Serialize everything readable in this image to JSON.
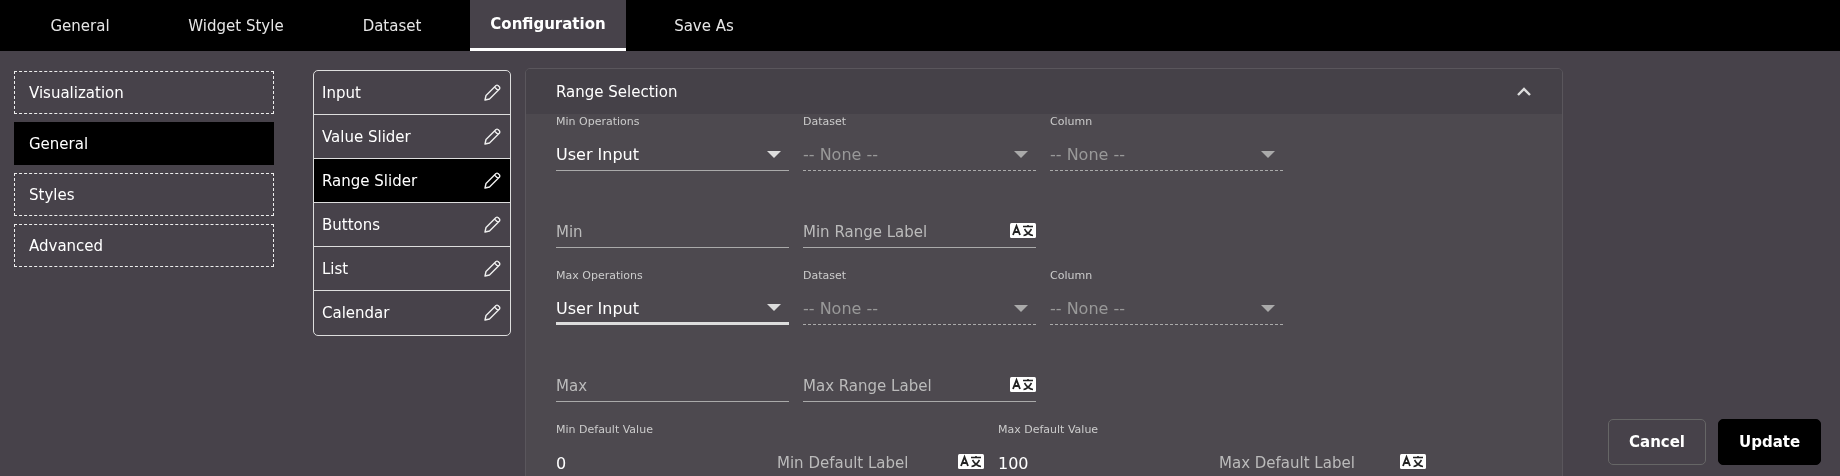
{
  "tabs": [
    {
      "label": "General",
      "selected": false
    },
    {
      "label": "Widget Style",
      "selected": false
    },
    {
      "label": "Dataset",
      "selected": false
    },
    {
      "label": "Configuration",
      "selected": true
    },
    {
      "label": "Save As",
      "selected": false
    }
  ],
  "sidebar": {
    "items": [
      {
        "label": "Visualization",
        "selected": false
      },
      {
        "label": "General",
        "selected": true
      },
      {
        "label": "Styles",
        "selected": false
      },
      {
        "label": "Advanced",
        "selected": false
      }
    ]
  },
  "widget_types": [
    {
      "label": "Input",
      "selected": false
    },
    {
      "label": "Value Slider",
      "selected": false
    },
    {
      "label": "Range Slider",
      "selected": true
    },
    {
      "label": "Buttons",
      "selected": false
    },
    {
      "label": "List",
      "selected": false
    },
    {
      "label": "Calendar",
      "selected": false
    }
  ],
  "panel": {
    "title": "Range Selection",
    "expanded": true,
    "rows": [
      [
        {
          "kind": "select",
          "label": "Min Operations",
          "value": "User Input",
          "disabled": false,
          "focused": false
        },
        {
          "kind": "select",
          "label": "Dataset",
          "value": "-- None --",
          "disabled": true,
          "focused": false
        },
        {
          "kind": "select",
          "label": "Column",
          "value": "-- None --",
          "disabled": true,
          "focused": false
        }
      ],
      [
        {
          "kind": "input",
          "placeholder": "Min",
          "translate": false
        },
        {
          "kind": "input",
          "placeholder": "Min Range Label",
          "translate": true
        }
      ],
      [
        {
          "kind": "select",
          "label": "Max Operations",
          "value": "User Input",
          "disabled": false,
          "focused": true
        },
        {
          "kind": "select",
          "label": "Dataset",
          "value": "-- None --",
          "disabled": true,
          "focused": false
        },
        {
          "kind": "select",
          "label": "Column",
          "value": "-- None --",
          "disabled": true,
          "focused": false
        }
      ],
      [
        {
          "kind": "input",
          "placeholder": "Max",
          "translate": false
        },
        {
          "kind": "input",
          "placeholder": "Max Range Label",
          "translate": true
        }
      ],
      [
        {
          "kind": "value",
          "label": "Min Default Value",
          "value": "0"
        },
        {
          "kind": "input",
          "placeholder": "Min Default Label",
          "translate": true
        },
        {
          "kind": "value",
          "label": "Max Default Value",
          "value": "100"
        },
        {
          "kind": "input",
          "placeholder": "Max Default Label",
          "translate": true
        }
      ]
    ]
  },
  "buttons": [
    {
      "label": "Cancel",
      "kind": "secondary"
    },
    {
      "label": "Update",
      "kind": "primary"
    }
  ]
}
